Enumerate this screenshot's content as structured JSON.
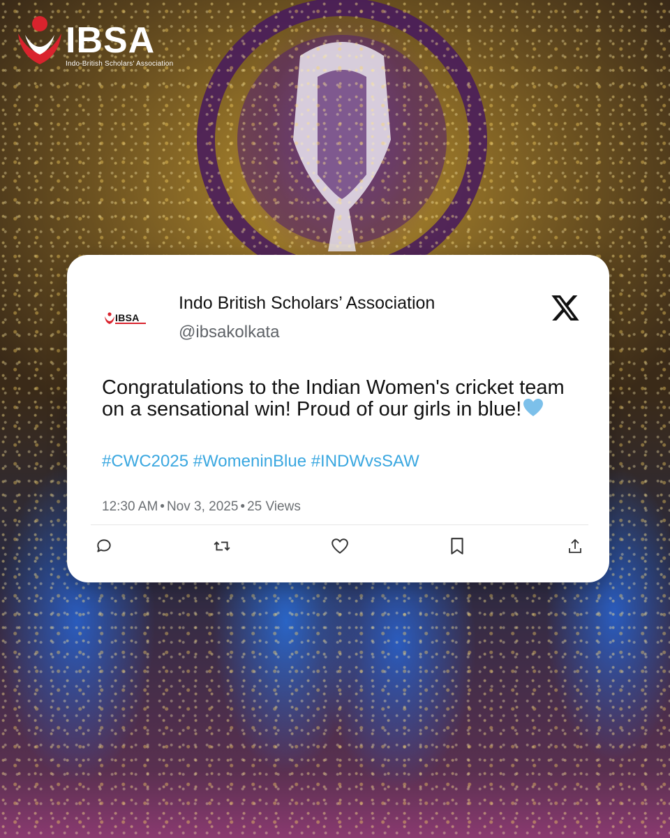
{
  "brand": {
    "logo_text": "IBSA",
    "logo_subtitle": "Indo-British Scholars' Association",
    "accent_red": "#d9232d"
  },
  "tweet": {
    "account_name": "Indo British Scholars’ Association",
    "handle": "@ibsakolkata",
    "avatar_text": "IBSA",
    "platform_icon": "x-logo-icon",
    "body": "Congratulations to the Indian Women's cricket team on a sensational win! Proud of our girls in blue!",
    "emoji": "light-blue-heart",
    "hashtags": "#CWC2025 #WomeninBlue #INDWvsSAW",
    "time": "12:30 AM",
    "date": "Nov 3, 2025",
    "views": "25 Views",
    "separator": "•",
    "hashtag_color": "#3aa7e0",
    "actions": [
      "reply-icon",
      "retweet-icon",
      "like-icon",
      "bookmark-icon",
      "share-icon"
    ]
  }
}
